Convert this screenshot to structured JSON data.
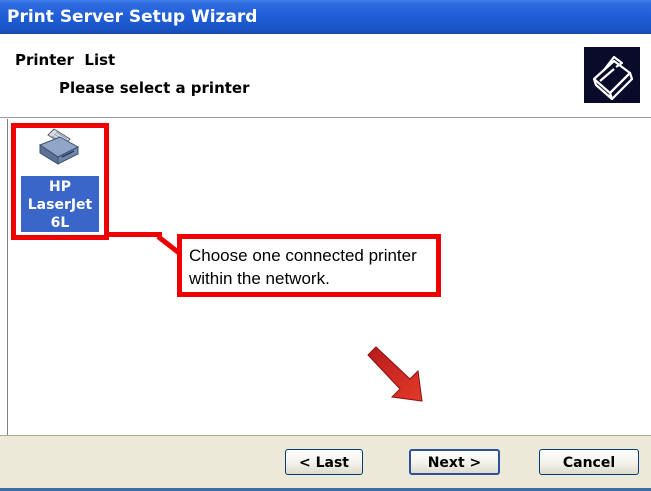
{
  "window": {
    "title": "Print Server Setup Wizard"
  },
  "header": {
    "title": "Printer  List",
    "subtitle": "Please select a printer",
    "icon": "printer-icon"
  },
  "printer_list": {
    "items": [
      {
        "label": "HP\nLaserJet\n6L",
        "icon": "printer-icon",
        "selected": true
      }
    ]
  },
  "annotation": {
    "text": "Choose one connected printer within the network.",
    "color": "#ee0000"
  },
  "buttons": {
    "last": "< Last",
    "next": "Next >",
    "cancel": "Cancel"
  },
  "colors": {
    "titlebar": "#1f5ed7",
    "selection": "#3966c8",
    "footer": "#ece9d8"
  }
}
